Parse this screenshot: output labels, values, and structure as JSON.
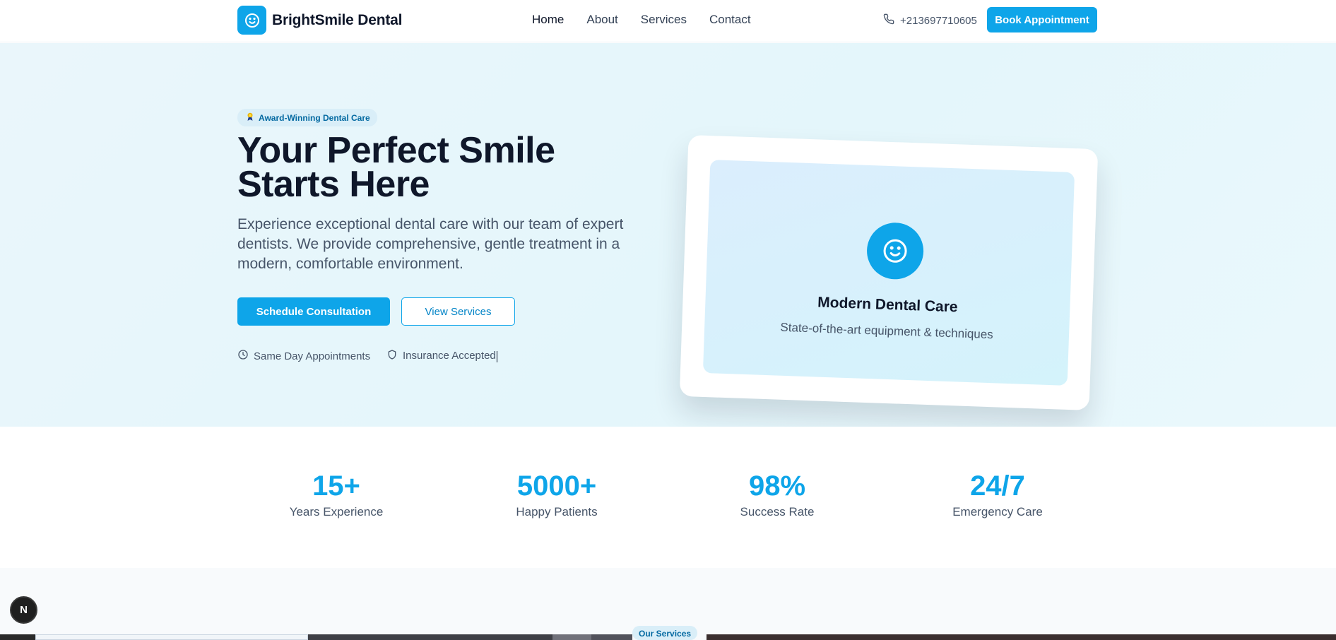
{
  "header": {
    "brand": "BrightSmile Dental",
    "nav": [
      {
        "label": "Home"
      },
      {
        "label": "About"
      },
      {
        "label": "Services"
      },
      {
        "label": "Contact"
      }
    ],
    "phone": "+213697710605",
    "cta": "Book Appointment"
  },
  "hero": {
    "badge": "Award-Winning Dental Care",
    "title_line1": "Your Perfect Smile",
    "title_line2": "Starts Here",
    "description": "Experience exceptional dental care with our team of expert dentists. We provide comprehensive, gentle treatment in a modern, comfortable environment.",
    "primary_button": "Schedule Consultation",
    "secondary_button": "View Services",
    "features": [
      {
        "label": "Same Day Appointments",
        "icon": "clock-icon"
      },
      {
        "label": "Insurance Accepted",
        "icon": "shield-icon"
      }
    ],
    "card": {
      "title": "Modern Dental Care",
      "subtitle": "State-of-the-art equipment & techniques",
      "icon": "smile-icon"
    }
  },
  "stats": [
    {
      "value": "15+",
      "label": "Years Experience"
    },
    {
      "value": "5000+",
      "label": "Happy Patients"
    },
    {
      "value": "98%",
      "label": "Success Rate"
    },
    {
      "value": "24/7",
      "label": "Emergency Care"
    }
  ],
  "services": {
    "badge": "Our Services"
  },
  "dev_indicator": "N",
  "colors": {
    "primary": "#0ea5e9",
    "text_dark": "#0f172a",
    "text_muted": "#475569",
    "hero_bg": "#e8f6fb",
    "badge_bg": "#d9eef8"
  }
}
